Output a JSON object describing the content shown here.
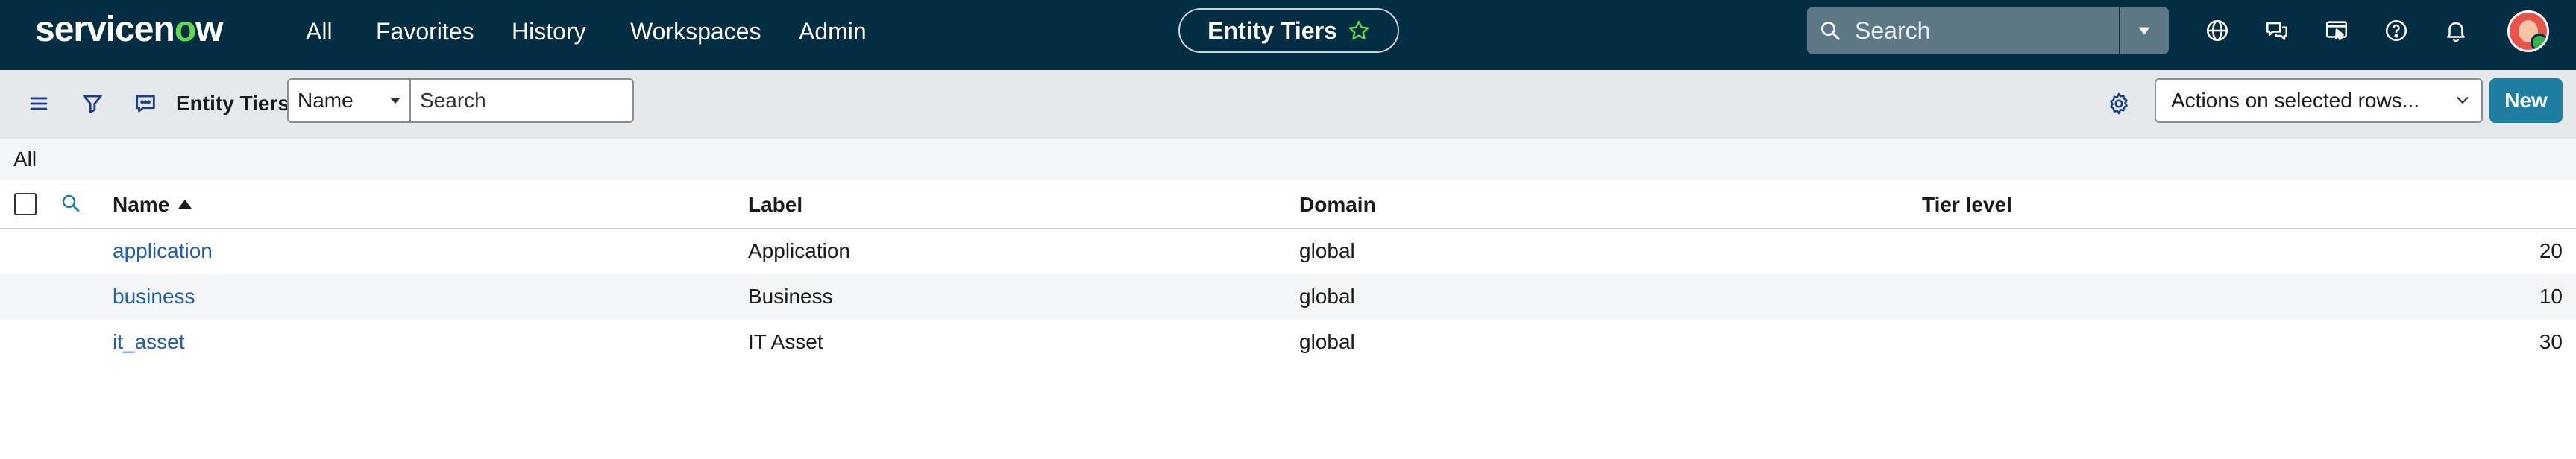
{
  "brand": {
    "logo_text_pre": "servicen",
    "logo_accent": "o",
    "logo_text_post": "w"
  },
  "nav": {
    "links": [
      "All",
      "Favorites",
      "History",
      "Workspaces",
      "Admin"
    ],
    "context_pill": "Entity Tiers",
    "search_placeholder": "Search",
    "icons": [
      "globe-icon",
      "chat-icon",
      "connect-icon",
      "help-icon",
      "bell-icon",
      "avatar"
    ]
  },
  "listbar": {
    "title": "Entity Tiers",
    "field_selected": "Name",
    "search_placeholder": "Search",
    "actions_label": "Actions on selected rows...",
    "new_label": "New"
  },
  "breadcrumb": {
    "label": "All"
  },
  "table": {
    "columns": [
      "Name",
      "Label",
      "Domain",
      "Tier level"
    ],
    "rows": [
      {
        "name": "application",
        "label": "Application",
        "domain": "global",
        "tier": "20"
      },
      {
        "name": "business",
        "label": "Business",
        "domain": "global",
        "tier": "10"
      },
      {
        "name": "it_asset",
        "label": "IT Asset",
        "domain": "global",
        "tier": "30"
      }
    ]
  },
  "colors": {
    "nav_bg": "#032d42",
    "accent_green": "#62d84e",
    "link": "#1f5fb4",
    "primary_button": "#1e7ea2"
  }
}
